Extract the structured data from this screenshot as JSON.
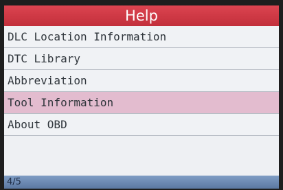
{
  "header": {
    "title": "Help"
  },
  "menu": {
    "items": [
      {
        "label": "DLC Location Information"
      },
      {
        "label": "DTC Library"
      },
      {
        "label": "Abbreviation"
      },
      {
        "label": "Tool Information",
        "selected": true
      },
      {
        "label": "About OBD"
      }
    ]
  },
  "status": {
    "page_indicator": "4/5"
  },
  "colors": {
    "title_bar": "#c93440",
    "selected_row": "#e3bccf",
    "status_bar": "#6d8ab3"
  }
}
